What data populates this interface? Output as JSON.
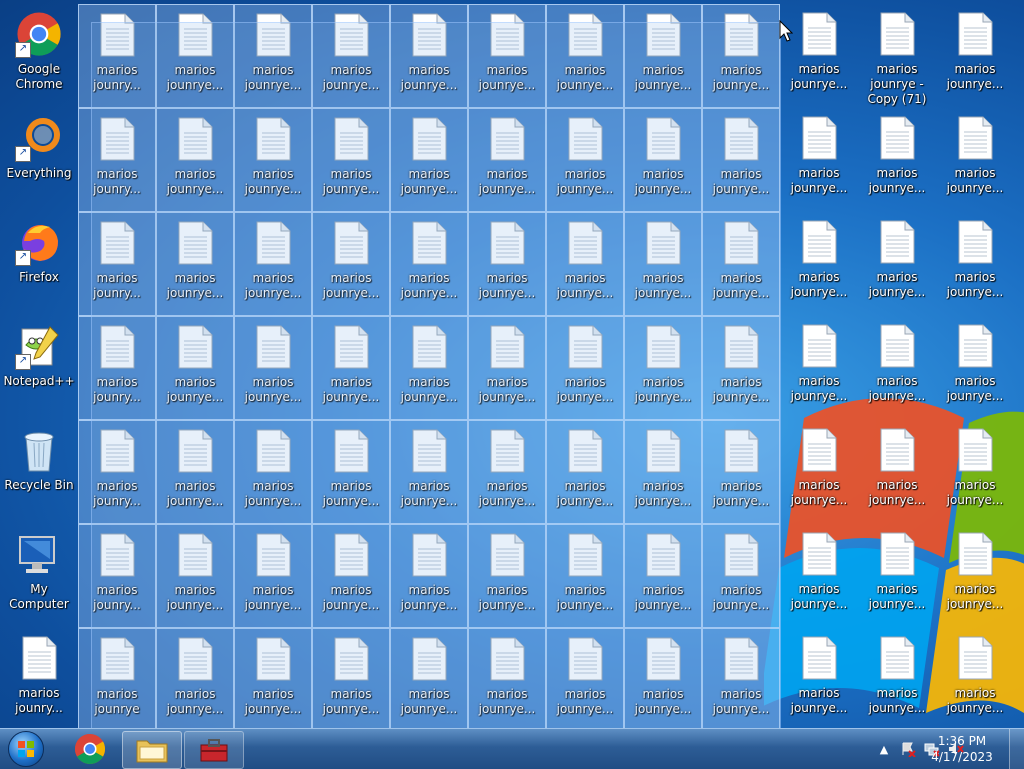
{
  "desktop": {
    "system_icons": [
      {
        "label": "Google Chrome",
        "icon": "chrome-icon"
      },
      {
        "label": "Everything",
        "icon": "everything-icon"
      },
      {
        "label": "Firefox",
        "icon": "firefox-icon"
      },
      {
        "label": "Notepad++",
        "icon": "notepadpp-icon"
      },
      {
        "label": "Recycle Bin",
        "icon": "recycle-bin-icon"
      },
      {
        "label": "My Computer",
        "icon": "computer-icon"
      },
      {
        "label": "marios jounry...",
        "icon": "text-file-icon"
      }
    ],
    "file_labels": {
      "short": "marios jounry...",
      "long": "marios jounrye...",
      "copy71": "marios jounrye - Copy (71)",
      "bottom_selected_first": "marios jounrye"
    },
    "file_icon": "text-file-icon"
  },
  "taskbar": {
    "start_icon": "windows-orb-icon",
    "pinned": [
      {
        "name": "chrome",
        "icon": "chrome-icon"
      },
      {
        "name": "explorer",
        "icon": "folder-icon"
      },
      {
        "name": "toolbox",
        "icon": "toolbox-icon"
      }
    ],
    "tray_icons": [
      "chevron-up-icon",
      "action-center-icon",
      "network-icon",
      "volume-muted-icon"
    ],
    "clock": {
      "time": "1:36 PM",
      "date": "4/17/2023"
    }
  },
  "colors": {
    "taskbar": "#2d5d96",
    "selection": "#add2ff",
    "desktop": "#1b6fc4"
  }
}
